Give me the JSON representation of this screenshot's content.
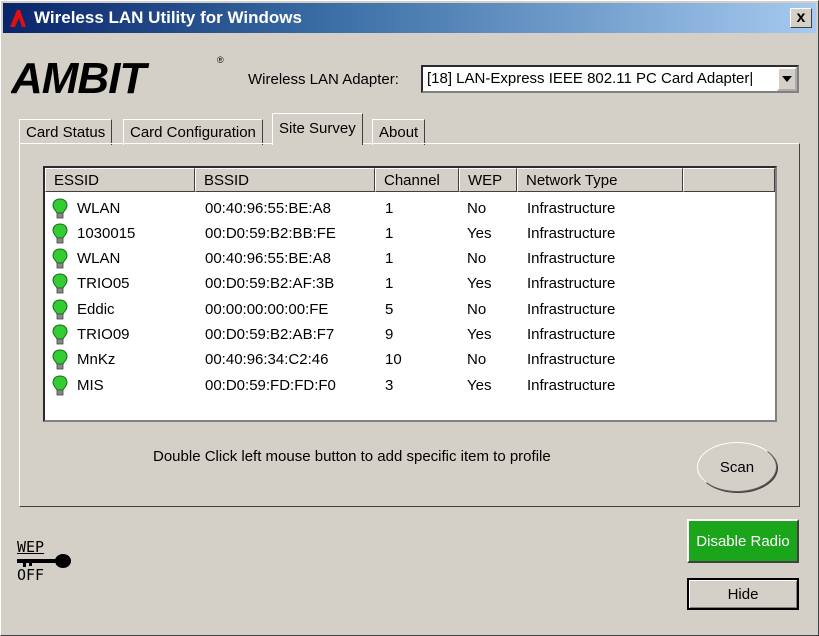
{
  "window": {
    "title": "Wireless LAN Utility for Windows",
    "close_label": "x"
  },
  "brand": {
    "logo_text": "AMBIT",
    "registered": "®"
  },
  "adapter": {
    "label": "Wireless LAN Adapter:",
    "value": "[18] LAN-Express IEEE 802.11 PC Card Adapter|"
  },
  "tabs": [
    {
      "label": "Card Status"
    },
    {
      "label": "Card Configuration"
    },
    {
      "label": "Site Survey",
      "active": true
    },
    {
      "label": "About"
    }
  ],
  "table": {
    "headers": [
      "ESSID",
      "BSSID",
      "Channel",
      "WEP",
      "Network Type"
    ],
    "rows": [
      {
        "essid": "WLAN",
        "bssid": "00:40:96:55:BE:A8",
        "channel": "1",
        "wep": "No",
        "type": "Infrastructure"
      },
      {
        "essid": "1030015",
        "bssid": "00:D0:59:B2:BB:FE",
        "channel": "1",
        "wep": "Yes",
        "type": "Infrastructure"
      },
      {
        "essid": "WLAN",
        "bssid": "00:40:96:55:BE:A8",
        "channel": "1",
        "wep": "No",
        "type": "Infrastructure"
      },
      {
        "essid": "TRIO05",
        "bssid": "00:D0:59:B2:AF:3B",
        "channel": "1",
        "wep": "Yes",
        "type": "Infrastructure"
      },
      {
        "essid": "Eddic",
        "bssid": "00:00:00:00:00:FE",
        "channel": "5",
        "wep": "No",
        "type": "Infrastructure"
      },
      {
        "essid": "TRIO09",
        "bssid": "00:D0:59:B2:AB:F7",
        "channel": "9",
        "wep": "Yes",
        "type": "Infrastructure"
      },
      {
        "essid": "MnKz",
        "bssid": "00:40:96:34:C2:46",
        "channel": "10",
        "wep": "No",
        "type": "Infrastructure"
      },
      {
        "essid": "MIS",
        "bssid": "00:D0:59:FD:FD:F0",
        "channel": "3",
        "wep": "Yes",
        "type": "Infrastructure"
      }
    ]
  },
  "hint": "Double Click left mouse button to add specific item to profile",
  "buttons": {
    "scan": "Scan",
    "disable_radio": "Disable Radio",
    "hide": "Hide"
  },
  "wep_status": {
    "line1": "WEP",
    "line2": "OFF"
  },
  "icons": {
    "bulb": "signal-bulb-icon",
    "key": "wep-key-icon"
  },
  "colors": {
    "bulb": "#33cc33",
    "disable_radio_bg": "#1aa51a",
    "title_gradient_start": "#0a246a"
  }
}
